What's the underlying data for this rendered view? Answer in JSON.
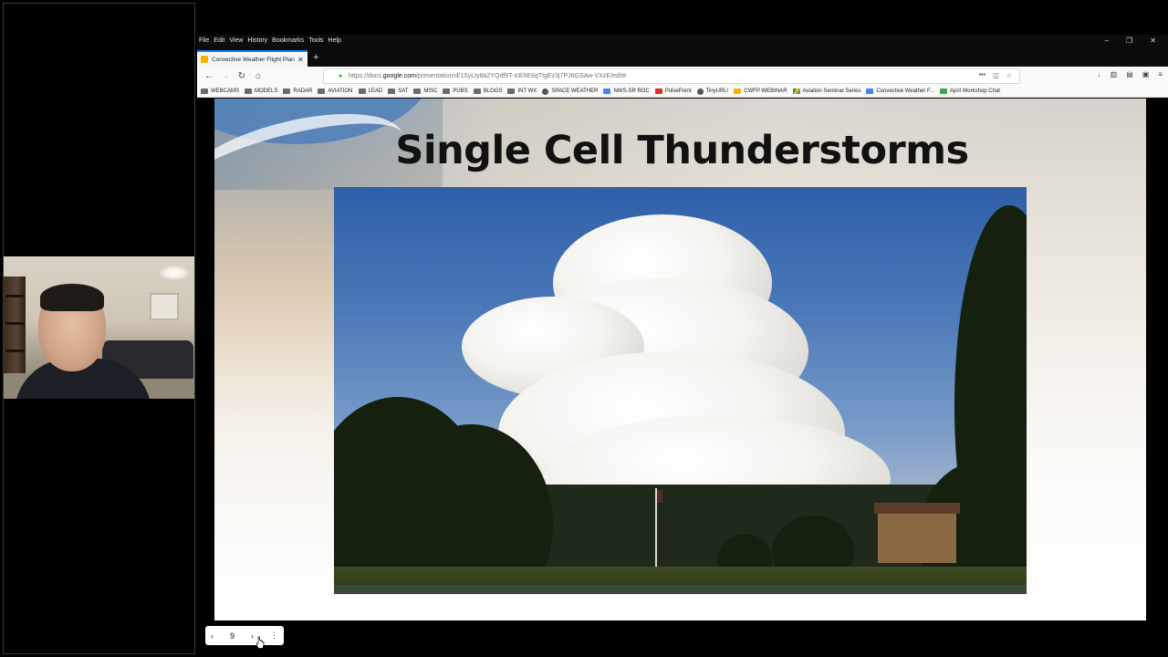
{
  "browser": {
    "menu": [
      "File",
      "Edit",
      "View",
      "History",
      "Bookmarks",
      "Tools",
      "Help"
    ],
    "tab_title": "Convective Weather Flight Plan",
    "new_tab_label": "+",
    "url_host_prefix": "https://docs.",
    "url_host": "google.com",
    "url_path": "/presentation/d/1SyLty8a2YQdf9T-IcEhE6qTIgEz3j7PJ6GSAw-VXzE/edit#",
    "bookmarks": [
      {
        "label": "WEBCAMS",
        "icon": "folder-icon"
      },
      {
        "label": "MODELS",
        "icon": "folder-icon"
      },
      {
        "label": "RADAR",
        "icon": "folder-icon"
      },
      {
        "label": "AVIATION",
        "icon": "folder-icon"
      },
      {
        "label": "LEAD",
        "icon": "folder-icon"
      },
      {
        "label": "SAT",
        "icon": "folder-icon"
      },
      {
        "label": "MISC",
        "icon": "folder-icon"
      },
      {
        "label": "PUBS",
        "icon": "folder-icon"
      },
      {
        "label": "BLOGS",
        "icon": "folder-icon"
      },
      {
        "label": "INT WX",
        "icon": "folder-icon"
      },
      {
        "label": "SPACE WEATHER",
        "icon": "globe-icon"
      },
      {
        "label": "NWS-SR ROC",
        "icon": "page-icon"
      },
      {
        "label": "PulsePoint",
        "icon": "pulsepoint-icon"
      },
      {
        "label": "TinyURL!",
        "icon": "globe-icon"
      },
      {
        "label": "CWFP WEBINAR",
        "icon": "doc-icon"
      },
      {
        "label": "Aviation Seminar Series",
        "icon": "drive-icon"
      },
      {
        "label": "Convective Weather F...",
        "icon": "docs-icon"
      },
      {
        "label": "April Workshop Chat",
        "icon": "chat-icon"
      }
    ]
  },
  "slide": {
    "title": "Single Cell Thunderstorms",
    "page_number": "9",
    "prev_label": "‹",
    "next_label": "›",
    "more_label": "⋮"
  },
  "colors": {
    "tab_accent": "#0a84ff",
    "secure_lock": "#12bc00",
    "sky": "#2f5fa8"
  }
}
